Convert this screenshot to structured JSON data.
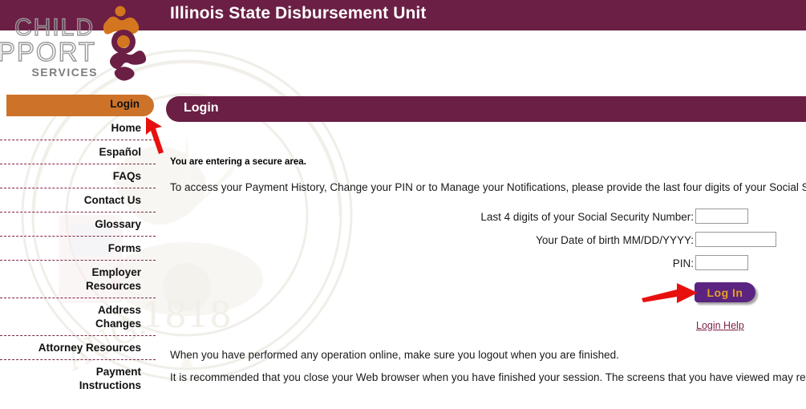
{
  "header": {
    "title": "Illinois State Disbursement Unit",
    "bar_color": "#6B1F45"
  },
  "logo": {
    "line1": "CHILD",
    "line2": "SUPPORT",
    "line3": "SERVICES",
    "icon_name": "parent-child-figures-logo",
    "orange": "#D4761F",
    "maroon": "#6B1F45",
    "gray": "#8C8C8C"
  },
  "sidebar": {
    "active_index": 0,
    "active_color": "#CC7329",
    "items": [
      {
        "label": "Login"
      },
      {
        "label": "Home"
      },
      {
        "label": "Español"
      },
      {
        "label": "FAQs"
      },
      {
        "label": "Contact Us"
      },
      {
        "label": "Glossary"
      },
      {
        "label": "Forms"
      },
      {
        "label": "Employer Resources"
      },
      {
        "label": "Address Changes"
      },
      {
        "label": "Attorney Resources"
      },
      {
        "label": "Payment Instructions"
      }
    ]
  },
  "main": {
    "banner_label": "Login",
    "secure_note": "You are entering a secure area.",
    "intro_text": "To access your Payment History, Change your PIN or to Manage your Notifications, please provide the last four digits of your Social Security",
    "form": {
      "fields": [
        {
          "label": "Last 4 digits of your Social Security Number:",
          "value": "",
          "placeholder": ""
        },
        {
          "label": "Your Date of birth MM/DD/YYYY:",
          "value": "",
          "placeholder": ""
        },
        {
          "label": "PIN:",
          "value": "",
          "placeholder": ""
        }
      ],
      "submit_label": "Log In",
      "submit_bg": "#5B2480",
      "submit_fg": "#E8A020",
      "help_link": "Login Help"
    },
    "footer_line_1": "When you have performed any operation online, make sure you logout when you are finished.",
    "footer_line_2": "It is recommended that you close your Web browser when you have finished your session. The screens that you have viewed may remain in"
  },
  "annotations": {
    "arrow_color": "#E8100F",
    "arrow_sidebar_name": "red-arrow-pointing-to-login-menu",
    "arrow_login_name": "red-arrow-pointing-to-log-in-button"
  }
}
